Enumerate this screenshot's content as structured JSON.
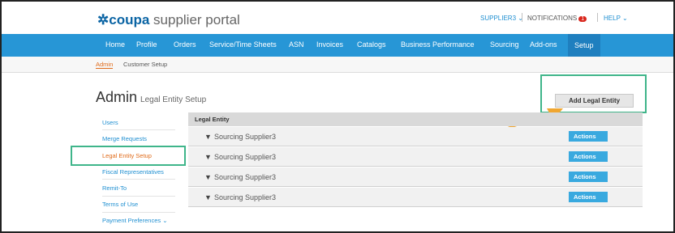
{
  "brand": {
    "mark": "✲",
    "name": "coupa",
    "suffix": " supplier portal"
  },
  "utility": {
    "account": "SUPPLIER3 ⌄",
    "notifications": "NOTIFICATIONS",
    "notification_count": "1",
    "help": "HELP ⌄"
  },
  "nav": {
    "items": [
      "Home",
      "Profile",
      "Orders",
      "Service/Time Sheets",
      "ASN",
      "Invoices",
      "Catalogs",
      "Business Performance",
      "Sourcing",
      "Add-ons",
      "Setup"
    ],
    "active": "Setup"
  },
  "subnav": {
    "items": [
      "Admin",
      "Customer Setup"
    ],
    "active": "Admin"
  },
  "page": {
    "title": "Admin",
    "subtitle": "Legal Entity Setup",
    "add_button": "Add Legal Entity"
  },
  "sidebar": {
    "items": [
      "Users",
      "Merge Requests",
      "Legal Entity Setup",
      "Fiscal Representatives",
      "Remit-To",
      "Terms of Use",
      "Payment Preferences ⌄"
    ],
    "active": "Legal Entity Setup"
  },
  "table": {
    "header": "Legal Entity",
    "rows": [
      {
        "name": "Sourcing Supplier3",
        "action": "Actions"
      },
      {
        "name": "Sourcing Supplier3",
        "action": "Actions"
      },
      {
        "name": "Sourcing Supplier3",
        "action": "Actions"
      },
      {
        "name": "Sourcing Supplier3",
        "action": "Actions"
      }
    ]
  },
  "colors": {
    "nav": "#2796d6",
    "highlight": "#3fb58a",
    "arrow": "#f0a630",
    "actions": "#39a9df",
    "active_sub": "#e06b1a"
  }
}
